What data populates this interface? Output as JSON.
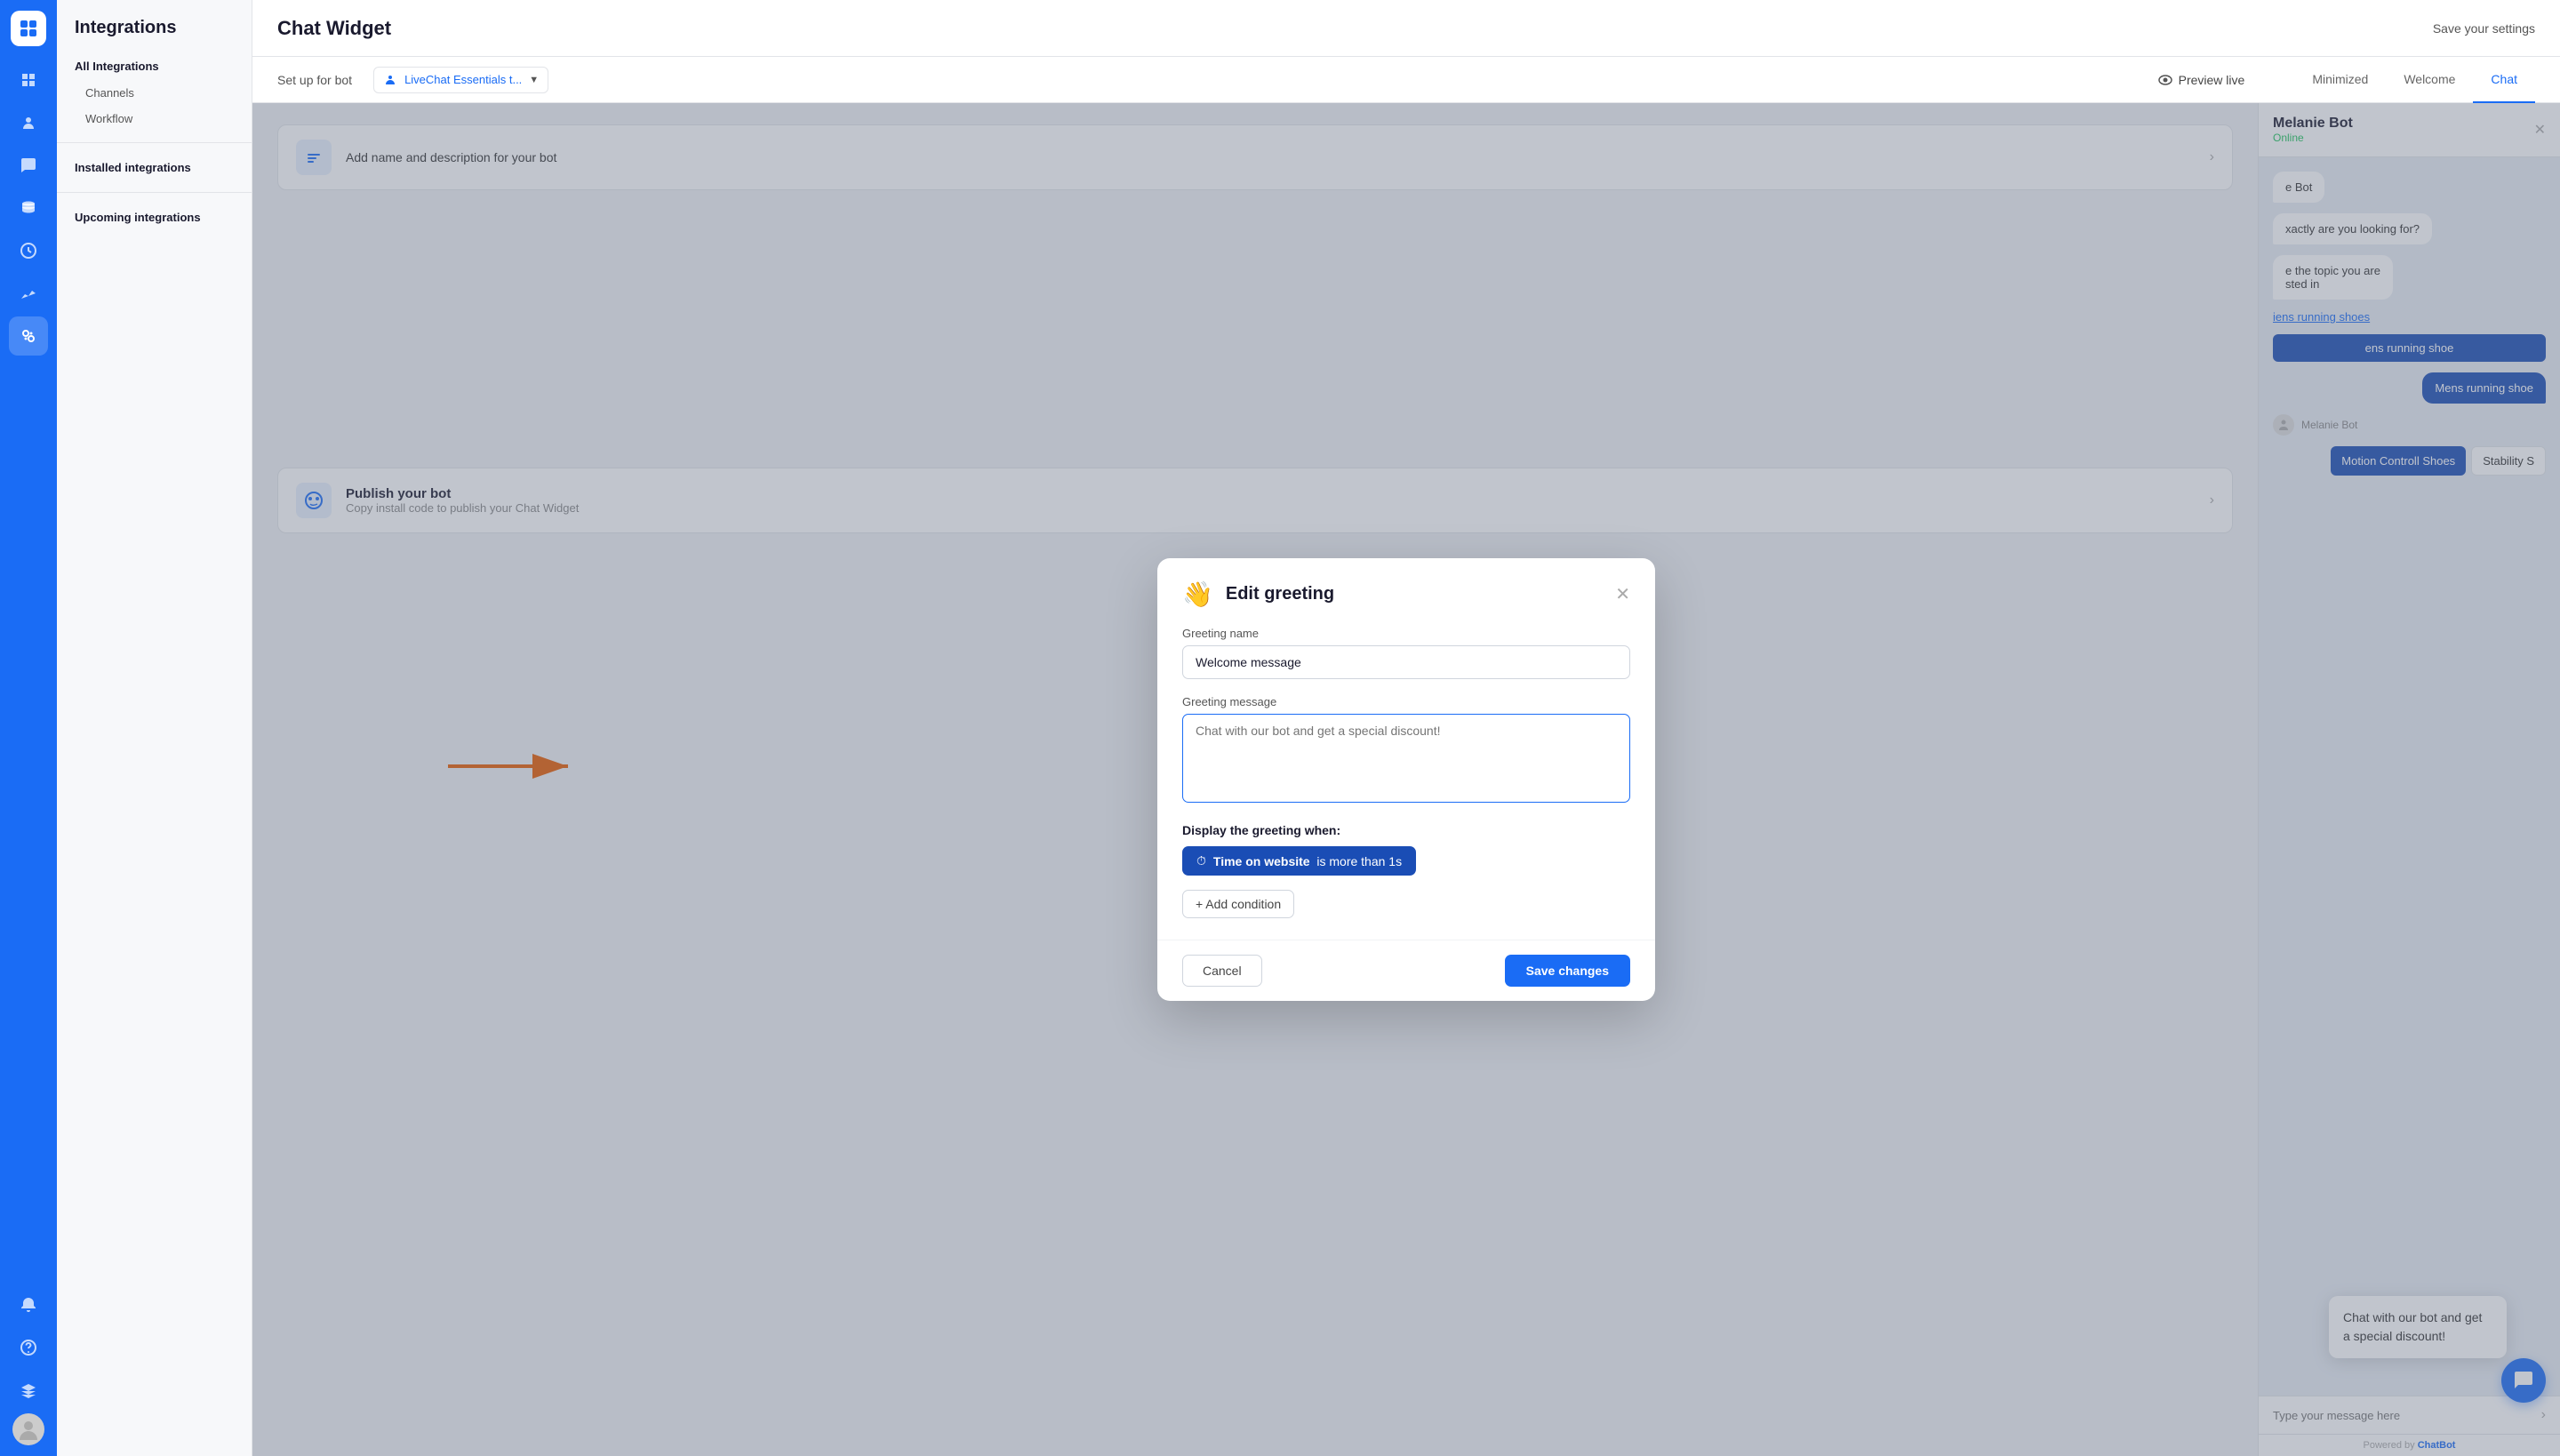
{
  "app": {
    "title": "Chat Widget",
    "save_settings_label": "Save your settings"
  },
  "left_nav": {
    "title": "Integrations",
    "sections": [
      {
        "label": "All Integrations",
        "items": [
          "Channels",
          "Workflow"
        ]
      },
      {
        "label": "Installed integrations"
      },
      {
        "label": "Upcoming integrations"
      }
    ]
  },
  "sidebar": {
    "icons": [
      {
        "name": "dashboard-icon",
        "symbol": "⊞"
      },
      {
        "name": "contacts-icon",
        "symbol": "👤"
      },
      {
        "name": "chat-icon",
        "symbol": "💬"
      },
      {
        "name": "database-icon",
        "symbol": "🗄"
      },
      {
        "name": "clock-icon",
        "symbol": "⏱"
      },
      {
        "name": "analytics-icon",
        "symbol": "📈"
      },
      {
        "name": "integrations-icon",
        "symbol": "⚙"
      },
      {
        "name": "bell-icon",
        "symbol": "🔔"
      },
      {
        "name": "help-icon",
        "symbol": "?"
      },
      {
        "name": "academy-icon",
        "symbol": "🎓"
      }
    ]
  },
  "top_bar": {
    "bot_selector_label": "LiveChat Essentials t...",
    "preview_live_label": "Preview live",
    "tabs": [
      "Minimized",
      "Welcome",
      "Chat"
    ],
    "active_tab": "Chat"
  },
  "sub_bar": {
    "set_up_label": "Set up for bot"
  },
  "bot_step": {
    "title": "Add name and description for your bot",
    "publish_title": "Publish your bot",
    "publish_sub": "Copy install code to publish your Chat Widget"
  },
  "modal": {
    "title": "Edit greeting",
    "icon": "👋",
    "greeting_name_label": "Greeting name",
    "greeting_name_value": "Welcome message",
    "greeting_message_label": "Greeting message",
    "greeting_message_placeholder": "Chat with our bot and get a special discount!",
    "display_when_label": "Display the greeting when:",
    "condition": {
      "icon": "⏱",
      "text_before": "Time on website",
      "text_after": "is more than 1s"
    },
    "add_condition_label": "+ Add condition",
    "cancel_label": "Cancel",
    "save_label": "Save changes"
  },
  "chat_preview": {
    "bot_name": "Melanie Bot",
    "bot_status": "Online",
    "messages": [
      {
        "type": "bot",
        "text": "e Bot"
      },
      {
        "type": "bot",
        "text": "xactly are you looking for?"
      },
      {
        "type": "bot_multiline",
        "text": "e the topic you are\nsted in"
      },
      {
        "type": "link",
        "text": "iens running shoes"
      },
      {
        "type": "suggest_btn",
        "text": "ens running shoe"
      },
      {
        "type": "user",
        "text": "Mens running shoe"
      },
      {
        "type": "bot_row",
        "label": "Melanie Bot"
      },
      {
        "type": "suggest_btn2",
        "text": "Motion Controll Shoes"
      },
      {
        "type": "suggest_label",
        "text": "Stability S"
      }
    ],
    "greeting_popup": "Chat with our bot and get a special discount!",
    "input_placeholder": "Type your message here",
    "footer_text": "Powered by ",
    "footer_link": "ChatBot"
  }
}
